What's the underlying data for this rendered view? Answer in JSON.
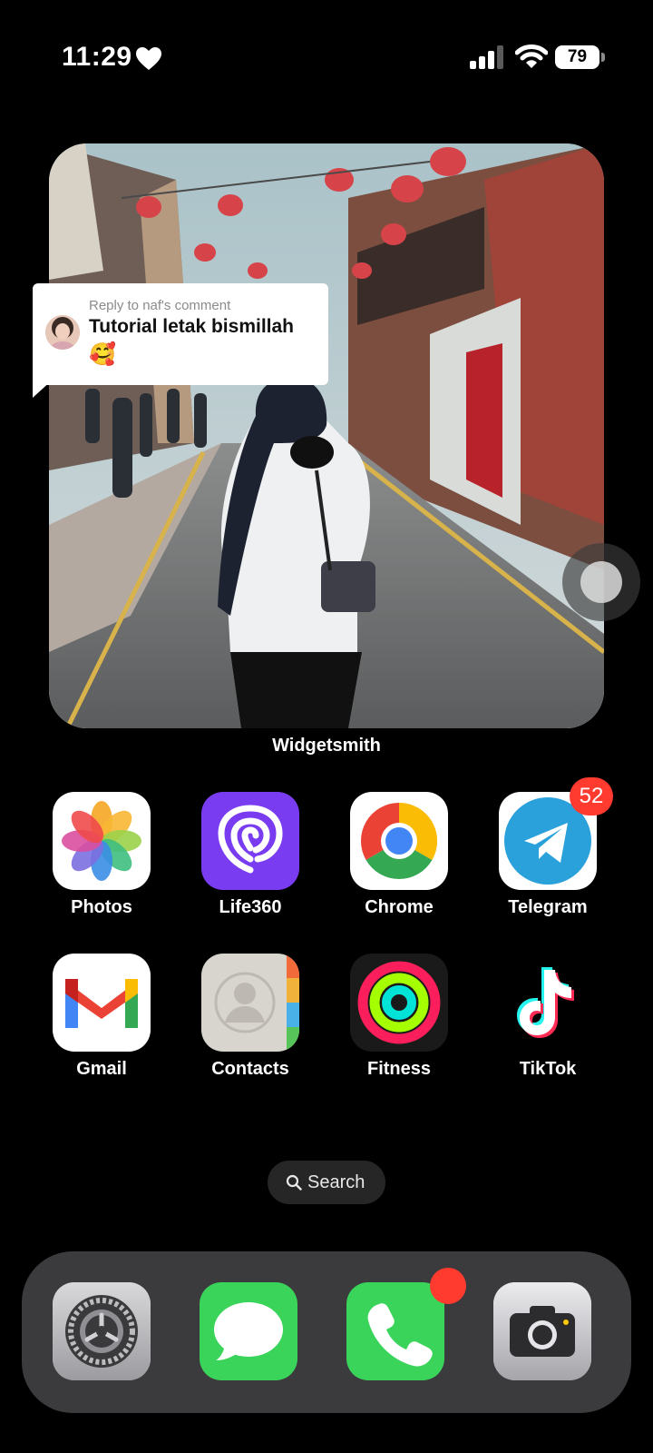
{
  "status_bar": {
    "time": "11:29",
    "battery": "79",
    "icons": [
      "heart-icon",
      "signal-icon",
      "wifi-icon",
      "battery-icon"
    ]
  },
  "widget": {
    "label": "Widgetsmith",
    "comment": {
      "reply_to": "Reply to naf's comment",
      "text": "Tutorial letak bismillah",
      "emoji": "🥰"
    }
  },
  "apps": [
    {
      "label": "Photos",
      "icon": "photos-icon"
    },
    {
      "label": "Life360",
      "icon": "life360-icon"
    },
    {
      "label": "Chrome",
      "icon": "chrome-icon"
    },
    {
      "label": "Telegram",
      "icon": "telegram-icon",
      "badge": "52"
    },
    {
      "label": "Gmail",
      "icon": "gmail-icon"
    },
    {
      "label": "Contacts",
      "icon": "contacts-icon"
    },
    {
      "label": "Fitness",
      "icon": "fitness-icon"
    },
    {
      "label": "TikTok",
      "icon": "tiktok-icon"
    }
  ],
  "search": {
    "label": "Search"
  },
  "dock": [
    {
      "icon": "settings-icon"
    },
    {
      "icon": "messages-icon"
    },
    {
      "icon": "phone-icon",
      "dot_badge": true
    },
    {
      "icon": "camera-icon"
    }
  ],
  "colors": {
    "background": "#000000",
    "badge": "#ff3b30",
    "dock": "#3b3b3d",
    "life360": "#7a3cf0",
    "messages_green": "#3ad45a"
  }
}
